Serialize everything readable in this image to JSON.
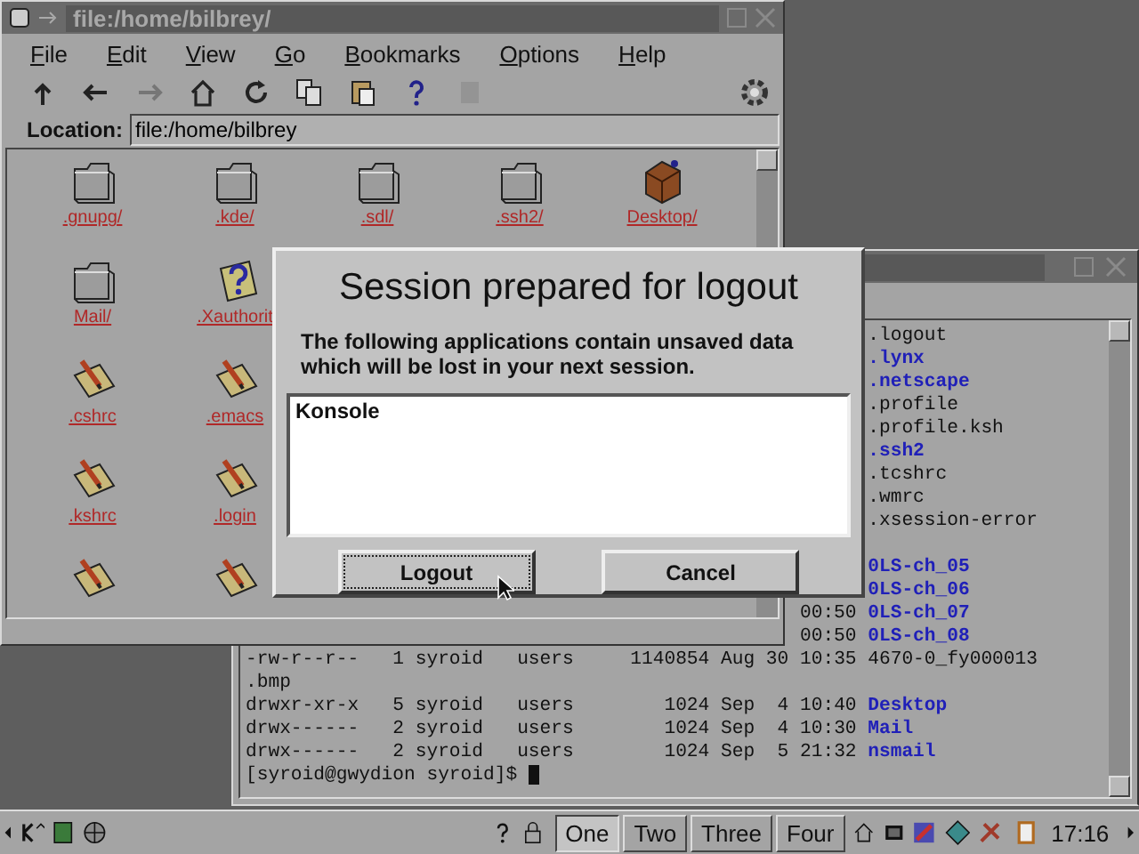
{
  "file_manager": {
    "title": "file:/home/bilbrey/",
    "menu": [
      {
        "label": "File"
      },
      {
        "label": "Edit"
      },
      {
        "label": "View"
      },
      {
        "label": "Go"
      },
      {
        "label": "Bookmarks"
      },
      {
        "label": "Options"
      },
      {
        "label": "Help"
      }
    ],
    "toolbar": [
      {
        "kind": "up",
        "disabled": false
      },
      {
        "kind": "back",
        "disabled": false
      },
      {
        "kind": "forward",
        "disabled": true
      },
      {
        "kind": "home",
        "disabled": false
      },
      {
        "kind": "reload",
        "disabled": false
      },
      {
        "kind": "copy",
        "disabled": false
      },
      {
        "kind": "paste",
        "disabled": false
      },
      {
        "kind": "help",
        "disabled": false
      },
      {
        "kind": "stop",
        "disabled": true
      }
    ],
    "location": {
      "label": "Location:",
      "value": "file:/home/bilbrey"
    },
    "icon_rows": [
      [
        {
          "kind": "folder",
          "label": ".gnupg/"
        },
        {
          "kind": "folder",
          "label": ".kde/"
        },
        {
          "kind": "folder",
          "label": ".sdl/"
        },
        {
          "kind": "folder",
          "label": ".ssh2/"
        },
        {
          "kind": "desktop",
          "label": "Desktop/"
        }
      ],
      [
        {
          "kind": "folder",
          "label": "Mail/"
        },
        {
          "kind": "unknown",
          "label": ".Xauthorit"
        }
      ],
      [
        {
          "kind": "text",
          "label": ".cshrc"
        },
        {
          "kind": "text",
          "label": ".emacs"
        }
      ],
      [
        {
          "kind": "text",
          "label": ".kshrc"
        },
        {
          "kind": "text",
          "label": ".login"
        }
      ],
      [
        {
          "kind": "text"
        },
        {
          "kind": "text"
        }
      ]
    ]
  },
  "terminal": {
    "lines": [
      {
        "kind": "file",
        "name": ".logout"
      },
      {
        "kind": "dir",
        "name": ".lynx"
      },
      {
        "kind": "dir",
        "name": ".netscape"
      },
      {
        "kind": "file",
        "name": ".profile"
      },
      {
        "kind": "file",
        "name": ".profile.ksh"
      },
      {
        "kind": "dir",
        "name": ".ssh2"
      },
      {
        "kind": "file",
        "name": ".tcshrc"
      },
      {
        "kind": "file",
        "name": ".wmrc"
      },
      {
        "kind": "file",
        "name": ".xsession-error"
      },
      {
        "kind": "blank"
      },
      {
        "kind": "dir",
        "name": "0LS-ch_05"
      },
      {
        "kind": "dir",
        "name": "0LS-ch_06"
      },
      {
        "kind": "dir",
        "prefix": "00:50",
        "name": "0LS-ch_07"
      },
      {
        "kind": "dir",
        "prefix": "00:50",
        "name": "0LS-ch_08"
      },
      {
        "kind": "file",
        "prefix": "-rw-r--r--   1 syroid   users     1140854 Aug 30 10:35",
        "name": "4670-0_fy000013"
      },
      {
        "kind": "wrap",
        "name": ".bmp"
      },
      {
        "kind": "dir",
        "prefix": "drwxr-xr-x   5 syroid   users        1024 Sep  4 10:40",
        "name": "Desktop"
      },
      {
        "kind": "dir",
        "prefix": "drwx------   2 syroid   users        1024 Sep  4 10:30",
        "name": "Mail"
      },
      {
        "kind": "dir",
        "prefix": "drwx------   2 syroid   users        1024 Sep  5 21:32",
        "name": "nsmail"
      },
      {
        "kind": "prompt",
        "name": "[syroid@gwydion syroid]$"
      }
    ]
  },
  "dialog": {
    "title": "Session prepared for logout",
    "message": "The following applications contain unsaved data which will be lost in your next session.",
    "list": [
      {
        "label": "Konsole"
      }
    ],
    "buttons": [
      {
        "label": "Logout",
        "focused": true
      },
      {
        "label": "Cancel",
        "focused": false
      }
    ]
  },
  "taskbar": {
    "desks": [
      {
        "label": "One",
        "selected": true
      },
      {
        "label": "Two",
        "selected": false
      },
      {
        "label": "Three",
        "selected": false
      },
      {
        "label": "Four",
        "selected": false
      }
    ],
    "clock": "17:16"
  }
}
